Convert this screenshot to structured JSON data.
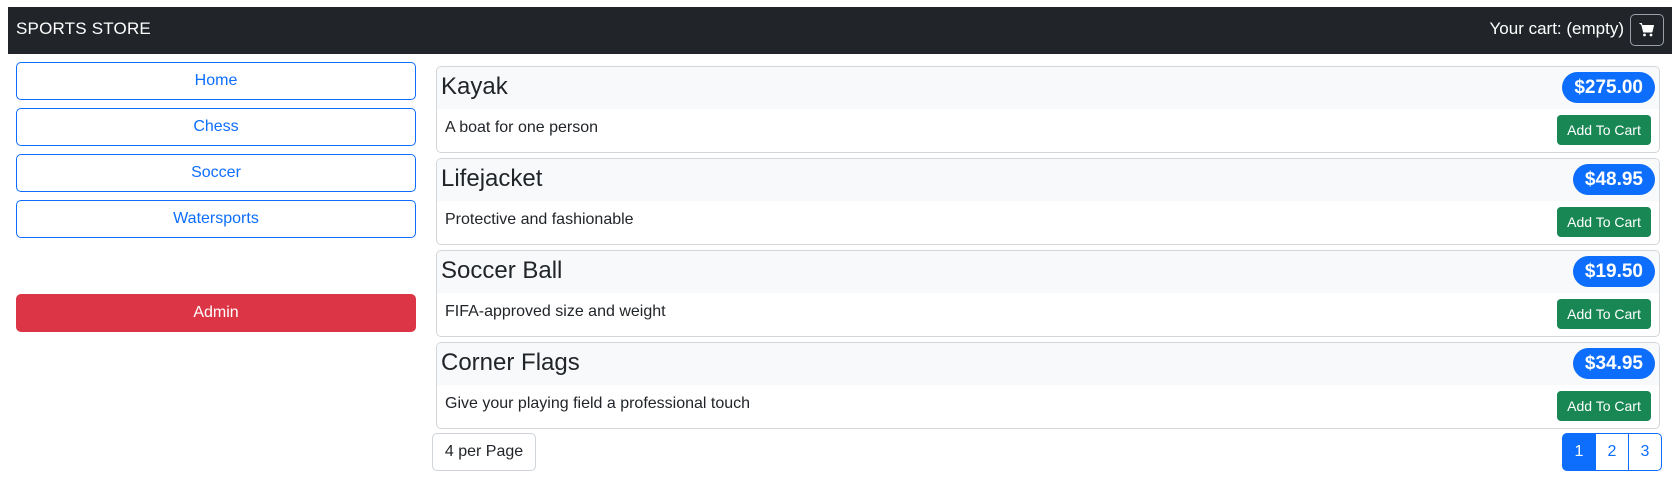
{
  "navbar": {
    "brand": "SPORTS STORE",
    "cart_summary": "Your cart: (empty)",
    "cart_icon": "cart-icon"
  },
  "sidebar": {
    "categories": [
      {
        "label": "Home"
      },
      {
        "label": "Chess"
      },
      {
        "label": "Soccer"
      },
      {
        "label": "Watersports"
      }
    ],
    "admin_label": "Admin"
  },
  "products": [
    {
      "name": "Kayak",
      "price": "$275.00",
      "description": "A boat for one person",
      "button": "Add To Cart"
    },
    {
      "name": "Lifejacket",
      "price": "$48.95",
      "description": "Protective and fashionable",
      "button": "Add To Cart"
    },
    {
      "name": "Soccer Ball",
      "price": "$19.50",
      "description": "FIFA-approved size and weight",
      "button": "Add To Cart"
    },
    {
      "name": "Corner Flags",
      "price": "$34.95",
      "description": "Give your playing field a professional touch",
      "button": "Add To Cart"
    }
  ],
  "pagination": {
    "page_size": "4 per Page",
    "pages": [
      "1",
      "2",
      "3"
    ],
    "current": "1"
  },
  "colors": {
    "navbar_bg": "#212529",
    "primary": "#0d6efd",
    "danger": "#dc3545",
    "success": "#198754"
  }
}
